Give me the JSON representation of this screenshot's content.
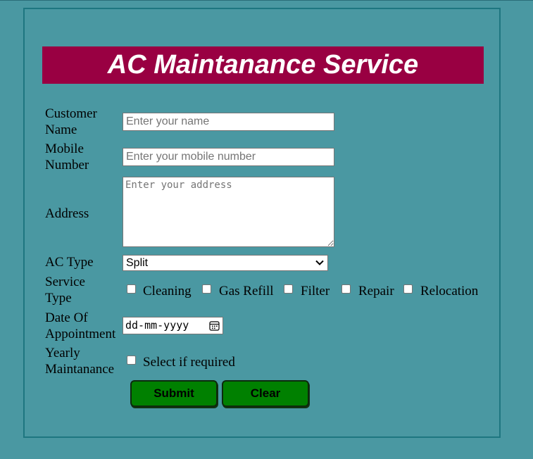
{
  "header": {
    "title": "AC Maintanance Service"
  },
  "form": {
    "customer_name": {
      "label_line1": "Customer",
      "label_line2": "Name",
      "placeholder": "Enter your name",
      "value": ""
    },
    "mobile_number": {
      "label_line1": "Mobile",
      "label_line2": "Number",
      "placeholder": "Enter your mobile number",
      "value": ""
    },
    "address": {
      "label": "Address",
      "placeholder": "Enter your address",
      "value": ""
    },
    "ac_type": {
      "label": "AC Type",
      "selected": "Split"
    },
    "service_type": {
      "label_line1": "Service",
      "label_line2": "Type",
      "options": [
        {
          "label": "Cleaning",
          "checked": false
        },
        {
          "label": "Gas Refill",
          "checked": false
        },
        {
          "label": "Filter",
          "checked": false
        },
        {
          "label": "Repair",
          "checked": false
        },
        {
          "label": "Relocation",
          "checked": false
        }
      ]
    },
    "date_of_appointment": {
      "label_line1": "Date Of",
      "label_line2": "Appointment",
      "placeholder": "dd-mm-yyyy",
      "icon": "calendar-icon"
    },
    "yearly_maintanance": {
      "label_line1": "Yearly",
      "label_line2": "Maintanance",
      "option_label": "Select if required",
      "checked": false
    },
    "buttons": {
      "submit": "Submit",
      "clear": "Clear"
    }
  },
  "colors": {
    "background": "#4a98a2",
    "banner": "#990042",
    "panel_border": "#1e7680",
    "button": "#008000"
  }
}
